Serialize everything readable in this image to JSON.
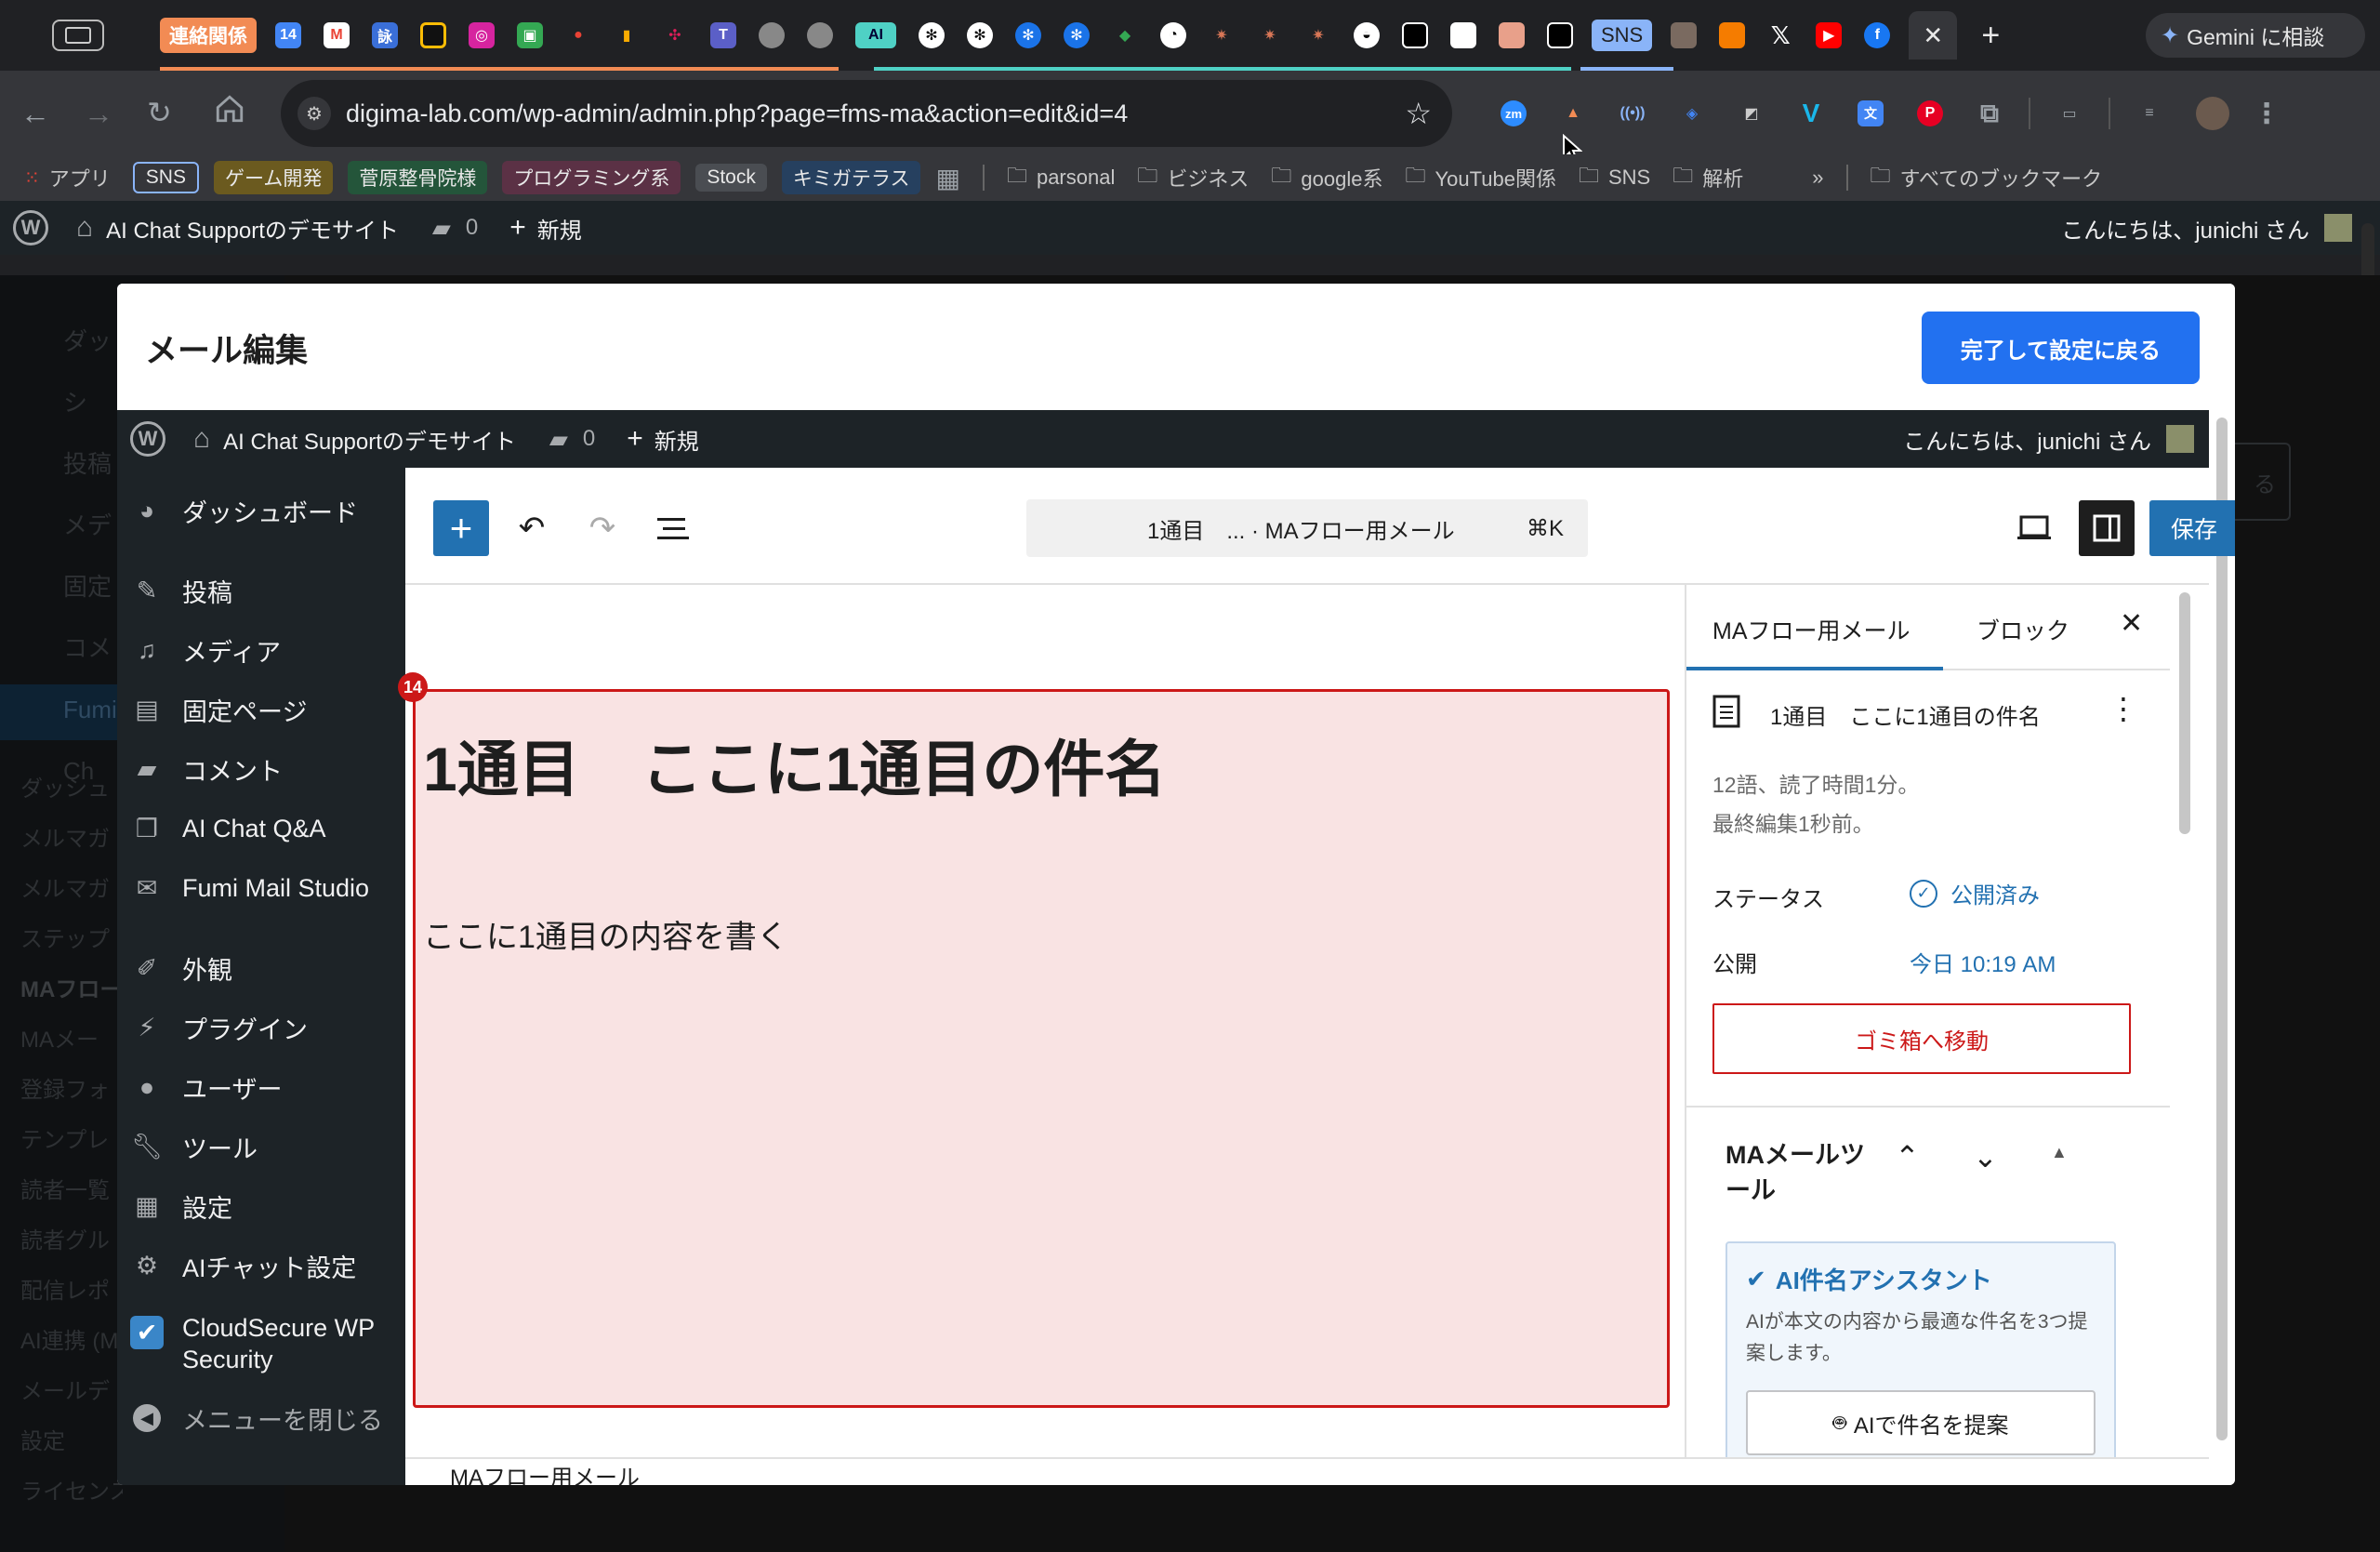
{
  "browser": {
    "tab_tag_label": "連絡関係",
    "tab_ai_label": "AI",
    "tab_sns_label": "SNS",
    "gemini_label": "Gemini に相談",
    "url": "digima-lab.com/wp-admin/admin.php?page=fms-ma&action=edit&id=4",
    "bookmarks": {
      "apps": "アプリ",
      "tags": [
        "SNS",
        "ゲーム開発",
        "菅原整骨院様",
        "プログラミング系",
        "Stock",
        "キミガテラス"
      ],
      "folders": [
        "parsonal",
        "ビジネス",
        "google系",
        "YouTube関係",
        "SNS",
        "解析"
      ],
      "all_bookmarks": "すべてのブックマーク",
      "overflow": "»"
    }
  },
  "wp_bar": {
    "site_name": "AI Chat Supportのデモサイト",
    "comments_count": "0",
    "new_label": "新規",
    "greeting": "こんにちは、junichi さん"
  },
  "background_menu": [
    "ダッシ",
    "投稿",
    "メデ",
    "固定",
    "コメ",
    "AI Ch",
    "Fumi",
    "ダッシュ",
    "メルマガ",
    "メルマガ",
    "ステップ",
    "MAフロー",
    "MAメー",
    "登録フォ",
    "テンプレ",
    "読者一覧",
    "読者グル",
    "配信レポ",
    "AI連携 (M",
    "メールデ",
    "設定",
    "ライセンス認証"
  ],
  "background_button": "る",
  "modal": {
    "title": "メール編集",
    "done_button": "完了して設定に戻る"
  },
  "sidebar": {
    "items": [
      {
        "label": "ダッシュボード",
        "icon": "dashboard-icon"
      },
      {
        "label": "投稿",
        "icon": "pin-icon"
      },
      {
        "label": "メディア",
        "icon": "media-icon"
      },
      {
        "label": "固定ページ",
        "icon": "page-icon"
      },
      {
        "label": "コメント",
        "icon": "comment-icon"
      },
      {
        "label": "AI Chat Q&A",
        "icon": "chat-icon"
      },
      {
        "label": "Fumi Mail Studio",
        "icon": "mail-icon"
      },
      {
        "label": "外観",
        "icon": "brush-icon"
      },
      {
        "label": "プラグイン",
        "icon": "plugin-icon"
      },
      {
        "label": "ユーザー",
        "icon": "user-icon"
      },
      {
        "label": "ツール",
        "icon": "wrench-icon"
      },
      {
        "label": "設定",
        "icon": "settings-icon"
      },
      {
        "label": "AIチャット設定",
        "icon": "gear-icon"
      },
      {
        "label": "CloudSecure WP Security",
        "icon": "shield-icon"
      },
      {
        "label": "メニューを閉じる",
        "icon": "collapse-icon"
      }
    ]
  },
  "editor": {
    "command_bar": "1通目　... · MAフロー用メール",
    "shortcut": "⌘K",
    "save_label": "保存",
    "block_badge": "14",
    "heading": "1通目　ここに1通目の件名",
    "paragraph": "ここに1通目の内容を書く",
    "footer_breadcrumb": "MAフロー用メール"
  },
  "panel": {
    "tabs": [
      "MAフロー用メール",
      "ブロック"
    ],
    "doc_title": "1通目　ここに1通目の件名",
    "stats": "12語、読了時間1分。",
    "last_edit": "最終編集1秒前。",
    "status_label": "ステータス",
    "status_value": "公開済み",
    "publish_label": "公開",
    "publish_value": "今日 10:19 AM",
    "trash_button": "ゴミ箱へ移動",
    "section_title": "MAメールツール",
    "ai_title": "AI件名アシスタント",
    "ai_desc": "AIが本文の内容から最適な件名を3つ提案します。",
    "ai_button": "AIで件名を提案"
  },
  "colors": {
    "wp_dark": "#1d2327",
    "wp_blue": "#2271b1",
    "modal_accent": "#2271f0",
    "block_bg": "#f9e3e3",
    "block_border": "#cc1818",
    "trash_red": "#cc1818"
  }
}
